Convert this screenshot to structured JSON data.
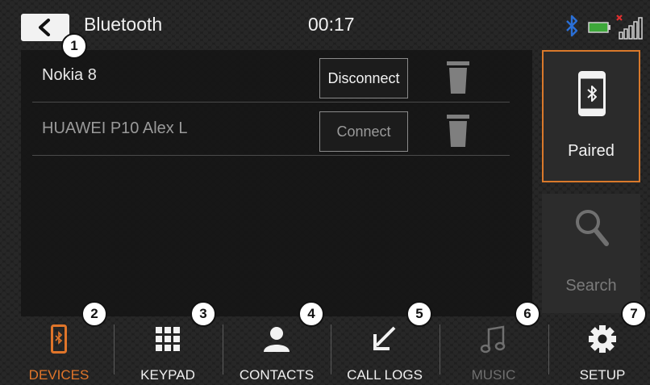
{
  "header": {
    "title": "Bluetooth",
    "clock": "00:17"
  },
  "callouts": [
    "1",
    "2",
    "3",
    "4",
    "5",
    "6",
    "7"
  ],
  "devices": [
    {
      "name": "Nokia 8",
      "action": "Disconnect",
      "dim": false
    },
    {
      "name": "HUAWEI P10 Alex L",
      "action": "Connect",
      "dim": true
    }
  ],
  "side": {
    "paired_label": "Paired",
    "search_label": "Search"
  },
  "nav": [
    {
      "label": "DEVICES",
      "icon": "phone-bluetooth-icon",
      "active": true
    },
    {
      "label": "KEYPAD",
      "icon": "keypad-icon"
    },
    {
      "label": "CONTACTS",
      "icon": "contacts-icon"
    },
    {
      "label": "CALL LOGS",
      "icon": "call-logs-icon"
    },
    {
      "label": "MUSIC",
      "icon": "music-icon",
      "disabled": true
    },
    {
      "label": "SETUP",
      "icon": "gear-icon"
    }
  ],
  "colors": {
    "accent": "#e0752a",
    "background": "#1f1f1f",
    "panel": "#161616",
    "bluetooth": "#2a6fd6"
  }
}
